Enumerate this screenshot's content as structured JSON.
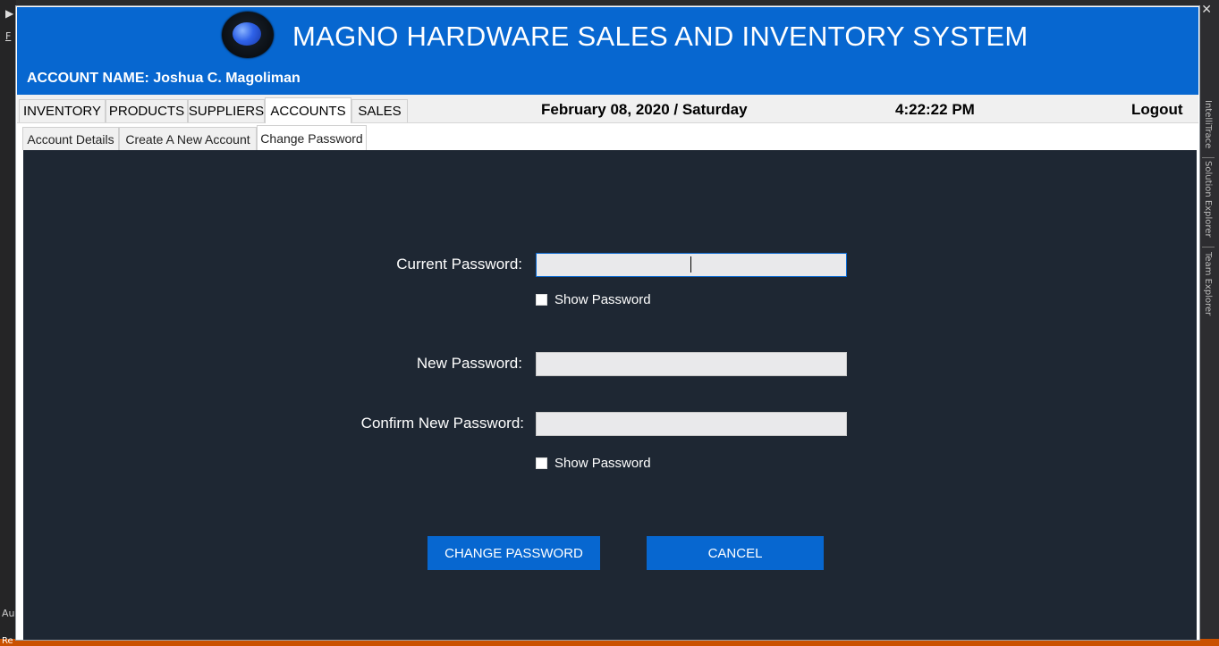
{
  "app": {
    "title": "MAGNO HARDWARE SALES AND INVENTORY SYSTEM",
    "account_label": "ACCOUNT NAME: Joshua C. Magoliman"
  },
  "nav": {
    "tabs": [
      "INVENTORY",
      "PRODUCTS",
      "SUPPLIERS",
      "ACCOUNTS",
      "SALES"
    ],
    "active_tab": "ACCOUNTS",
    "date": "February 08, 2020 / Saturday",
    "time": "4:22:22 PM",
    "logout": "Logout"
  },
  "subnav": {
    "tabs": [
      "Account Details",
      "Create A New Account",
      "Change Password"
    ],
    "active_tab": "Change Password"
  },
  "form": {
    "current_password_label": "Current Password:",
    "current_password_value": "",
    "show_password_1": "Show Password",
    "new_password_label": "New Password:",
    "new_password_value": "",
    "confirm_password_label": "Confirm New Password:",
    "confirm_password_value": "",
    "show_password_2": "Show Password",
    "change_button": "CHANGE PASSWORD",
    "cancel_button": "CANCEL"
  },
  "ide": {
    "right_tabs": [
      "IntelliTrace",
      "Solution Explorer",
      "Team Explorer"
    ],
    "left_fragment_top": "F",
    "left_fragment_bottom": "Au",
    "status_fragment": "Re"
  },
  "colors": {
    "header_blue": "#0767d0",
    "panel_bg": "#1e2733",
    "field_bg": "#e9e9eb",
    "ide_orange": "#ca5100"
  },
  "icons": {
    "logo": "blue-droplet-logo",
    "checkbox": "unchecked-square"
  }
}
